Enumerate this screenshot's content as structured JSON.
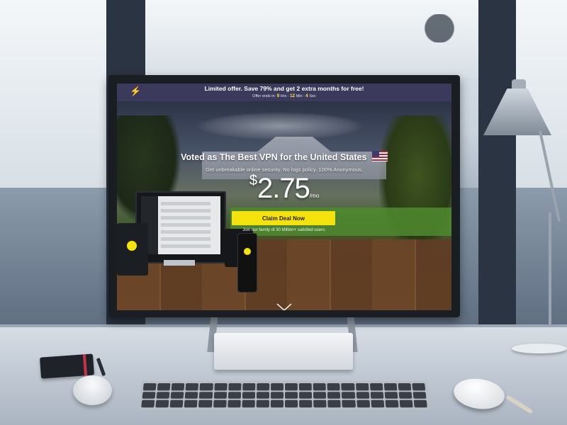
{
  "promo": {
    "icon": "lightning-icon",
    "title": "Limited offer. Save 79% and get 2 extra months for free!",
    "countdown": {
      "prefix": "Offer ends in:",
      "hours": "9",
      "hours_label": "Hrs",
      "minutes": "12",
      "minutes_label": "Min",
      "seconds": "4",
      "seconds_label": "Sec"
    }
  },
  "hero": {
    "title": "Voted as The Best VPN for the United States",
    "flag_icon": "us-flag-icon",
    "subtitle": "Get unbreakable online security. No logs policy. 100% Anonymous.",
    "price": {
      "currency": "$",
      "amount": "2.75",
      "period": "/mo"
    },
    "cta_label": "Claim Deal Now",
    "family_text": "Join our family of 30 Million+ satisfied users.",
    "scroll_icon": "chevron-down-icon"
  },
  "colors": {
    "accent": "#f4e20f",
    "promo_bar": "#3b3a5c",
    "countdown_number": "#ffe04b"
  }
}
